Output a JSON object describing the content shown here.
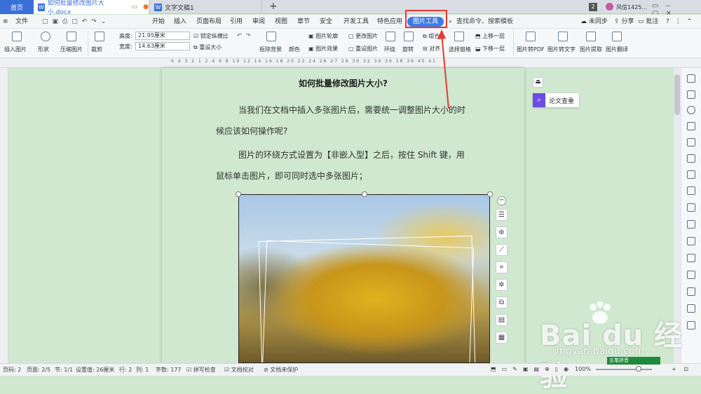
{
  "tabs": {
    "home": "首页",
    "doc": "如何批量修改图片大小.docx",
    "doc2": "文字文稿1",
    "add": "+",
    "badge": "2",
    "user": "风信1425...",
    "sync": "未同步",
    "share": "分享",
    "annotate": "批注"
  },
  "menu": {
    "file": "文件",
    "items": [
      "开始",
      "插入",
      "页面布局",
      "引用",
      "审阅",
      "视图",
      "章节",
      "安全",
      "开发工具",
      "特色应用",
      "图片工具"
    ],
    "search": "查找命令、搜索模板"
  },
  "toolbar": {
    "insert_pic": "插入图片",
    "shape": "形状",
    "compress": "压缩图片",
    "crop": "裁剪",
    "height_label": "高度:",
    "height_value": "21.95厘米",
    "width_label": "宽度:",
    "width_value": "14.63厘米",
    "lock_ratio": "锁定纵横比",
    "reset_size": "重设大小",
    "remove_bg": "抠除背景",
    "color": "颜色",
    "outline": "图片轮廓",
    "effect": "图片效果",
    "change_pic": "更改图片",
    "reset_pic": "重设图片",
    "wrap": "环绕",
    "rotate": "旋转",
    "group": "组合",
    "align": "对齐",
    "select_pane": "选择窗格",
    "bring_forward": "上移一层",
    "send_backward": "下移一层",
    "to_pdf": "图片转PDF",
    "to_text": "图片转文字",
    "extract": "图片提取",
    "translate": "图片翻译"
  },
  "ruler": "6 4 3 2 1 2 4 6 8 10 12 14 16 18 20 22 24 26 27 28 30 32 34 36 38 39 40 41",
  "doc": {
    "title": "如何批量修改图片大小?",
    "p1": "当我们在文档中插入多张图片后，需要统一调整图片大小的时候应该如何操作呢?",
    "p2": "图片的环绕方式设置为【非嵌入型】之后，按住 Shift 键，用鼠标单击图片，即可同时选中多张图片；"
  },
  "right_panel": {
    "check": "论文查重"
  },
  "status": {
    "page_no": "页码: 2",
    "pages": "页面: 2/5",
    "section": "节: 1/1",
    "setting": "设置值: 26厘米",
    "row": "行: 2",
    "col": "列: 1",
    "words": "字数: 177",
    "spell": "拼写检查",
    "proof": "文档校对",
    "protect": "文档未保护",
    "zoom": "100%",
    "ime": "五笔拼音"
  },
  "watermark": {
    "main": "Bai du 经验",
    "sub": "jingyan.baidu.com"
  },
  "colors": {
    "accent": "#3a7de8",
    "highlight": "#e53935",
    "page_bg": "#cfe8cf"
  }
}
